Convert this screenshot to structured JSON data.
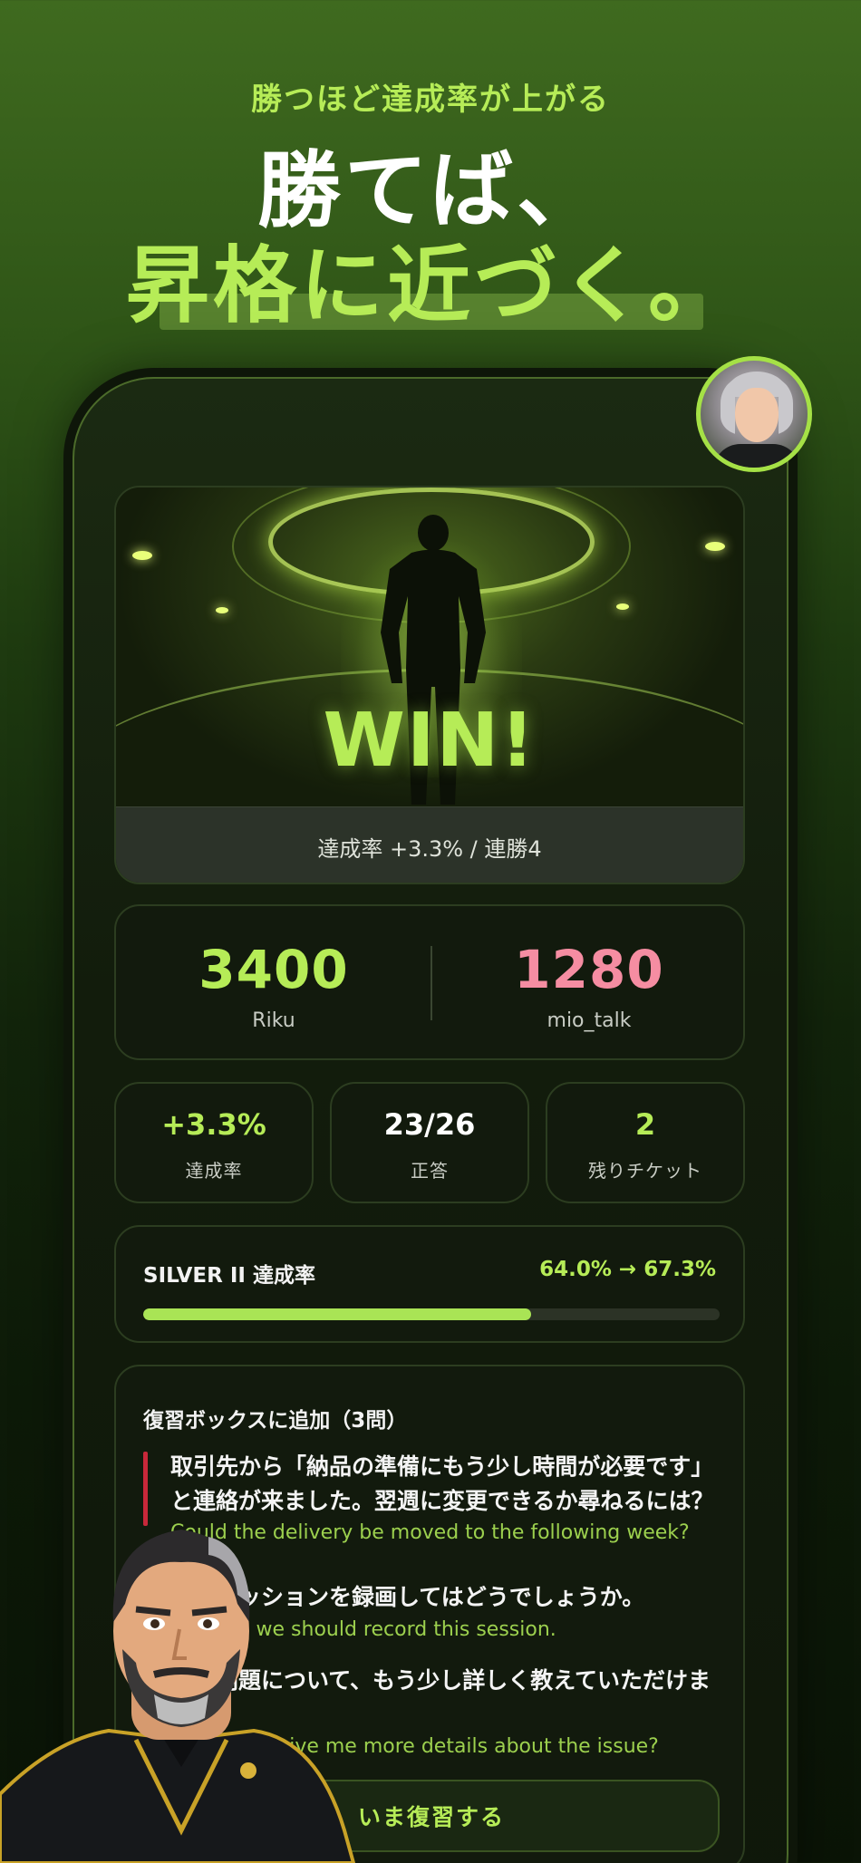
{
  "promo": {
    "eyebrow": "勝つほど達成率が上がる",
    "headline_line1": "勝てば、",
    "headline_line2": "昇格に近づく。"
  },
  "win_banner": {
    "title": "WIN!",
    "summary": "達成率 +3.3% / 連勝4"
  },
  "scoreboard": {
    "player": {
      "score": "3400",
      "name": "Riku",
      "color": "#b6ec57"
    },
    "opponent": {
      "score": "1280",
      "name": "mio_talk",
      "color": "#f58da2"
    }
  },
  "stats": [
    {
      "value": "+3.3%",
      "label": "達成率",
      "color": "#b6ec57"
    },
    {
      "value": "23/26",
      "label": "正答",
      "color": "#ffffff"
    },
    {
      "value": "2",
      "label": "残りチケット",
      "color": "#b6ec57"
    }
  ],
  "rank": {
    "title": "SILVER II 達成率",
    "value": "64.0% → 67.3%",
    "progress": 0.673
  },
  "review": {
    "title": "復習ボックスに追加（3問）",
    "items": [
      {
        "jp": "取引先から「納品の準備にもう少し時間が必要です」と連絡が来ました。翌週に変更できるか尋ねるには？",
        "en": "Could the delivery be moved to the following week?"
      },
      {
        "jp": "このセッションを録画してはどうでしょうか。",
        "en": "Perhaps we should record this session."
      },
      {
        "jp": "その問題について、もう少し詳しく教えていただけますか。",
        "en": "Could you give me more details about the issue?"
      }
    ],
    "button_label": "いま復習する"
  },
  "colors": {
    "accent": "#b6ec57",
    "opponent": "#f58da2",
    "review_marker": "#c8283a"
  }
}
